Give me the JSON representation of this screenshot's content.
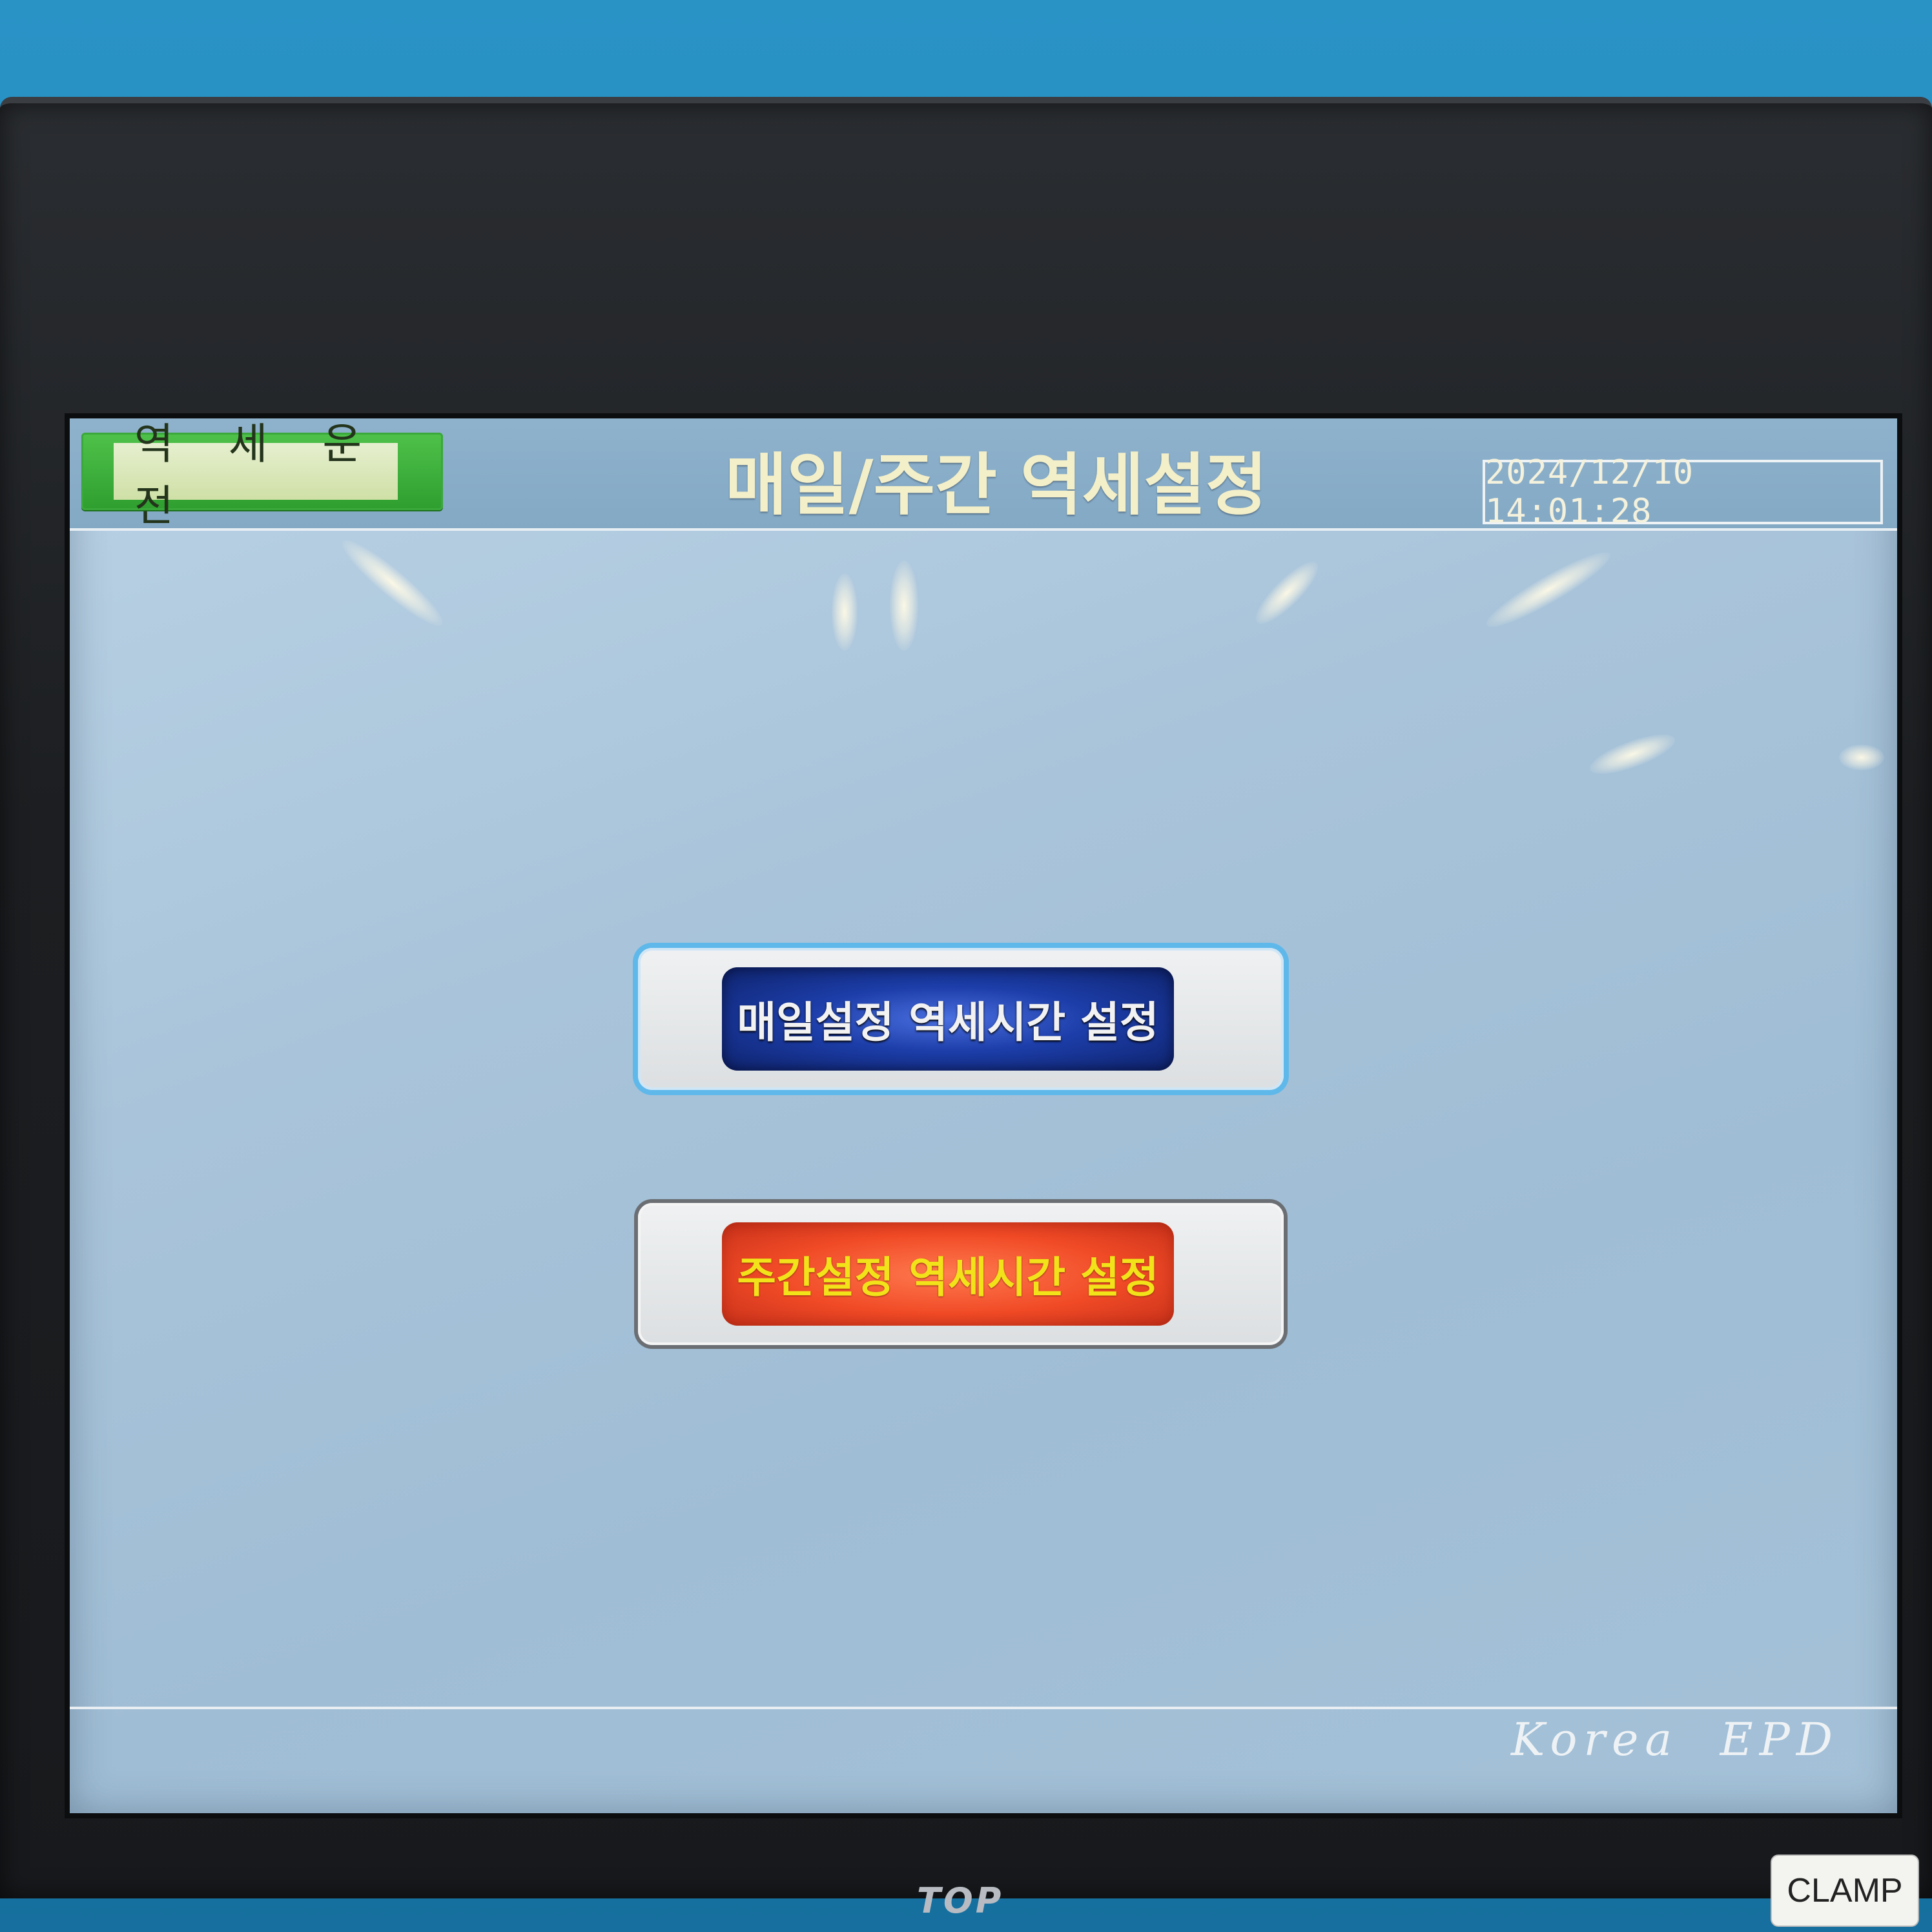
{
  "header": {
    "mode_label": "역 세 운 전",
    "title": "매일/주간 역세설정",
    "datetime": "2024/12/10 14:01:28"
  },
  "menu": {
    "daily_button": "매일설정 역세시간 설정",
    "weekly_button": "주간설정 역세시간 설정"
  },
  "footer": {
    "brand": "Korea  EPD"
  },
  "device": {
    "logo": "TOP",
    "sticker": "CLAMP"
  },
  "colors": {
    "mode_button": "#2e9e2f",
    "daily_button": "#1c3da8",
    "weekly_button": "#f04a26",
    "weekly_text": "#f2e21a",
    "screen_background": "#a9c4da"
  }
}
